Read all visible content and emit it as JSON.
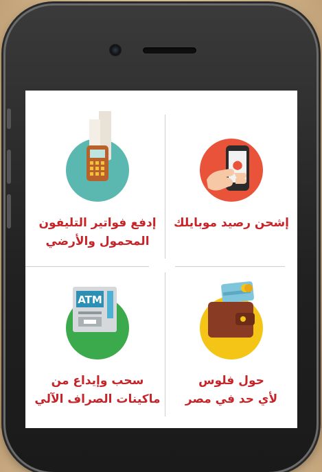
{
  "tiles": [
    {
      "label_lines": [
        "إشحن رصيد موبايلك"
      ],
      "icon": "phone-recharge-icon",
      "color": "#e8533a"
    },
    {
      "label_lines": [
        "إدفع فواتير التليفون",
        "المحمول والأرضي"
      ],
      "icon": "bill-payment-terminal-icon",
      "color": "#5bb8b0"
    },
    {
      "label_lines": [
        "حول فلوس",
        "لأي حد في مصر"
      ],
      "icon": "wallet-transfer-icon",
      "color": "#f4c517"
    },
    {
      "label_lines": [
        "سحب وإيداع من",
        "ماكينات الصراف الآلي"
      ],
      "icon": "atm-machine-icon",
      "color": "#3aaa4c",
      "atm_text": "ATM"
    }
  ],
  "colors": {
    "label": "#c62429",
    "divider": "#cfcfcf"
  }
}
